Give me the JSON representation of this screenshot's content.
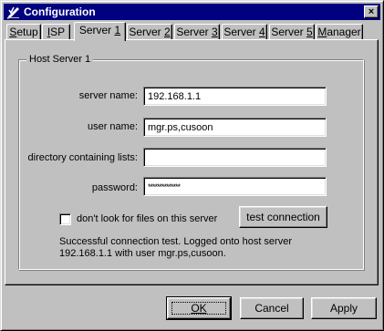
{
  "window": {
    "title": "Configuration",
    "close_glyph": "×"
  },
  "tabs": [
    {
      "label": "Setup",
      "mnemonic": "S",
      "rest": "etup",
      "active": false
    },
    {
      "label": "ISP",
      "mnemonic": "I",
      "rest": "SP",
      "active": false
    },
    {
      "label": "Server 1",
      "prefix": "Server ",
      "mnemonic": "1",
      "active": true
    },
    {
      "label": "Server 2",
      "prefix": "Server ",
      "mnemonic": "2",
      "active": false
    },
    {
      "label": "Server 3",
      "prefix": "Server ",
      "mnemonic": "3",
      "active": false
    },
    {
      "label": "Server 4",
      "prefix": "Server ",
      "mnemonic": "4",
      "active": false
    },
    {
      "label": "Server 5",
      "prefix": "Server ",
      "mnemonic": "5",
      "active": false
    },
    {
      "label": "Manager",
      "mnemonic": "M",
      "rest": "anager",
      "active": false
    }
  ],
  "group": {
    "label": "Host Server 1"
  },
  "form": {
    "server_name_label": "server name:",
    "server_name_value": "192.168.1.1",
    "user_name_label": "user name:",
    "user_name_value": "mgr.ps,cusoon",
    "directory_label": "directory containing lists:",
    "directory_value": "",
    "password_label": "password:",
    "password_value": "**************"
  },
  "checkbox": {
    "label": "don't look for files on this server",
    "checked": false
  },
  "test_button_label": "test connection",
  "status": {
    "line1": "Successful connection test.  Logged onto host server",
    "line2": "192.168.1.1 with user mgr.ps,cusoon."
  },
  "buttons": {
    "ok_label": "OK",
    "cancel_label": "Cancel",
    "apply_label": "Apply"
  },
  "colors": {
    "titlebar": "#000080",
    "face": "#c0c0c0"
  },
  "icons": {
    "title": "pencil-check-icon",
    "close": "close-icon"
  }
}
